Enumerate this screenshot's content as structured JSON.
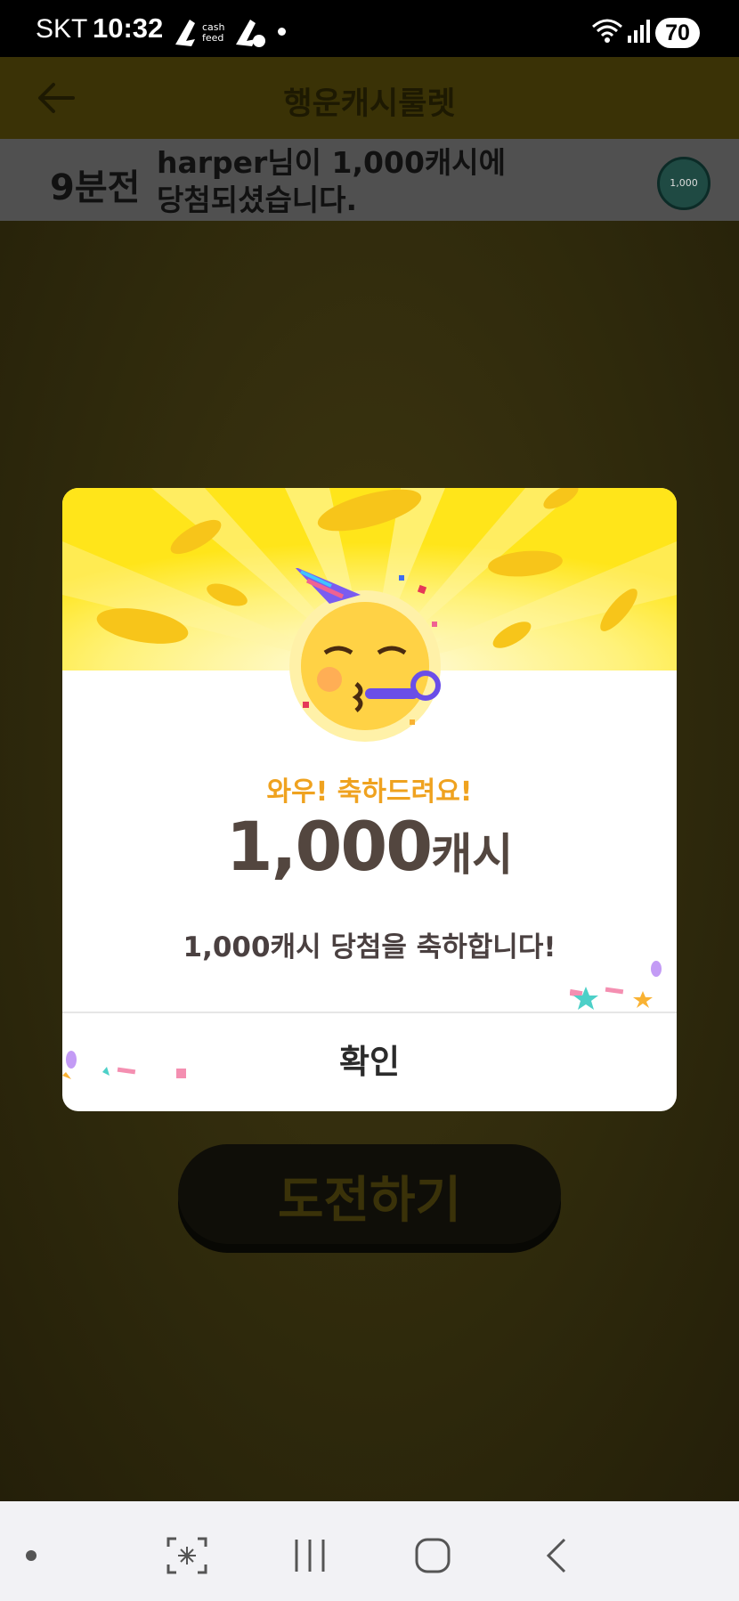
{
  "status_bar": {
    "carrier": "SKT",
    "time": "10:32",
    "battery": "70"
  },
  "header": {
    "title": "행운캐시룰렛"
  },
  "ticker": {
    "time_ago": "9분전",
    "message": "harper님이 1,000캐시에 당첨되셨습니다.",
    "coin_label": "1,000"
  },
  "main": {
    "challenge_button": "도전하기"
  },
  "modal": {
    "headline": "와우! 축하드려요!",
    "amount": "1,000",
    "amount_unit": "캐시",
    "message": "1,000캐시 당첨을 축하합니다!",
    "confirm_label": "확인"
  },
  "colors": {
    "accent_yellow": "#ffe51a",
    "headline_orange": "#efa21f",
    "amount_brown": "#53463f"
  },
  "icons": [
    "back-arrow-icon",
    "party-face-emoji",
    "wifi-icon",
    "signal-icon",
    "screenshot-icon",
    "recent-apps-icon",
    "home-icon",
    "back-icon"
  ]
}
